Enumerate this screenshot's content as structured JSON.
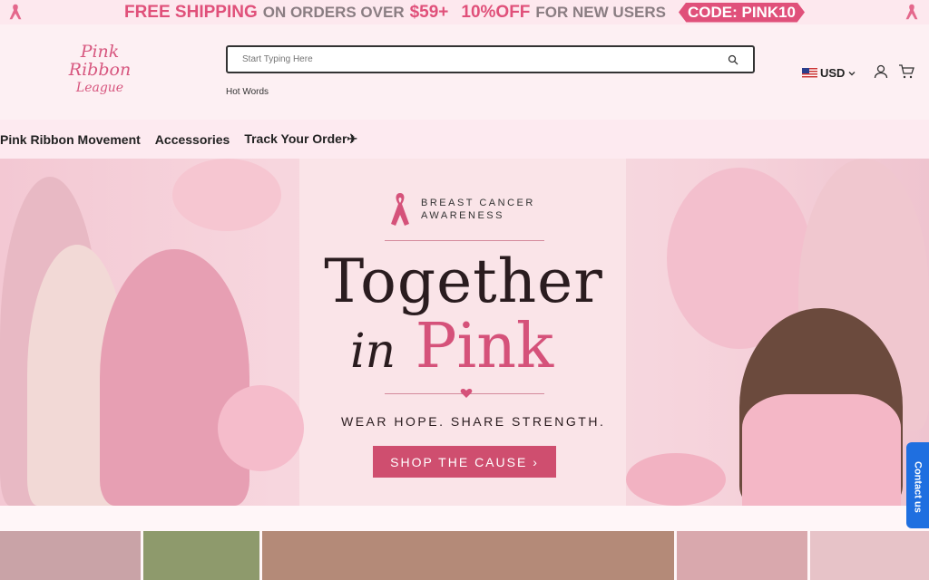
{
  "promo": {
    "free_shipping": "FREE SHIPPING",
    "on_orders": "ON ORDERS OVER",
    "amount": "$59+",
    "discount": "10%OFF",
    "new_users": "FOR NEW USERS",
    "code": "CODE: PINK10"
  },
  "logo": {
    "line1": "Pink",
    "line2": "Ribbon",
    "line3": "League"
  },
  "search": {
    "placeholder": "Start Typing Here"
  },
  "hot_words": "Hot Words",
  "currency": "USD",
  "nav": {
    "items": [
      "Pink Ribbon Movement",
      "Accessories",
      "Track Your Order✈"
    ]
  },
  "hero": {
    "awareness_line1": "BREAST CANCER",
    "awareness_line2": "AWARENESS",
    "headline_1": "Together",
    "headline_in": "in",
    "headline_pink": "Pink",
    "tagline": "WEAR HOPE. SHARE STRENGTH.",
    "cta": "SHOP THE CAUSE ›"
  },
  "contact": "Contact us",
  "colors": {
    "accent": "#d5527a",
    "cta": "#cf4e6f",
    "contact": "#1f6fe0"
  },
  "icons": [
    "ribbon-icon",
    "search-icon",
    "flag-icon",
    "chevron-down-icon",
    "user-icon",
    "cart-icon",
    "heart-icon",
    "chat-icon"
  ]
}
